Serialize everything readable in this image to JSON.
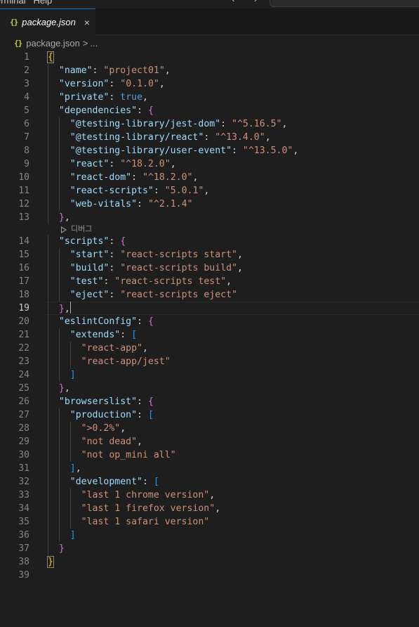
{
  "menubar": {
    "items": "erminal   Help",
    "nav": "‹ ›"
  },
  "tab": {
    "icon": "{}",
    "label": "package.json",
    "close": "×"
  },
  "breadcrumb": {
    "icon": "{}",
    "file": "package.json",
    "separator": ">",
    "ellipsis": "..."
  },
  "codelens": {
    "label": "디버그"
  },
  "editor": {
    "active_line": 19,
    "lines": [
      {
        "n": "1",
        "tokens": [
          [
            "{",
            "t-b1 match"
          ]
        ]
      },
      {
        "n": "2",
        "tokens": [
          [
            "  ",
            ""
          ],
          [
            "\"name\"",
            "t-key"
          ],
          [
            ": ",
            "t-punc"
          ],
          [
            "\"project01\"",
            "t-str"
          ],
          [
            ",",
            "t-punc"
          ]
        ]
      },
      {
        "n": "3",
        "tokens": [
          [
            "  ",
            ""
          ],
          [
            "\"version\"",
            "t-key"
          ],
          [
            ": ",
            "t-punc"
          ],
          [
            "\"0.1.0\"",
            "t-str"
          ],
          [
            ",",
            "t-punc"
          ]
        ]
      },
      {
        "n": "4",
        "tokens": [
          [
            "  ",
            ""
          ],
          [
            "\"private\"",
            "t-key"
          ],
          [
            ": ",
            "t-punc"
          ],
          [
            "true",
            "t-kw"
          ],
          [
            ",",
            "t-punc"
          ]
        ]
      },
      {
        "n": "5",
        "tokens": [
          [
            "  ",
            ""
          ],
          [
            "\"dependencies\"",
            "t-key"
          ],
          [
            ": ",
            "t-punc"
          ],
          [
            "{",
            "t-b2"
          ]
        ]
      },
      {
        "n": "6",
        "tokens": [
          [
            "    ",
            ""
          ],
          [
            "\"@testing-library/jest-dom\"",
            "t-key"
          ],
          [
            ": ",
            "t-punc"
          ],
          [
            "\"^5.16.5\"",
            "t-str"
          ],
          [
            ",",
            "t-punc"
          ]
        ]
      },
      {
        "n": "7",
        "tokens": [
          [
            "    ",
            ""
          ],
          [
            "\"@testing-library/react\"",
            "t-key"
          ],
          [
            ": ",
            "t-punc"
          ],
          [
            "\"^13.4.0\"",
            "t-str"
          ],
          [
            ",",
            "t-punc"
          ]
        ]
      },
      {
        "n": "8",
        "tokens": [
          [
            "    ",
            ""
          ],
          [
            "\"@testing-library/user-event\"",
            "t-key"
          ],
          [
            ": ",
            "t-punc"
          ],
          [
            "\"^13.5.0\"",
            "t-str"
          ],
          [
            ",",
            "t-punc"
          ]
        ]
      },
      {
        "n": "9",
        "tokens": [
          [
            "    ",
            ""
          ],
          [
            "\"react\"",
            "t-key"
          ],
          [
            ": ",
            "t-punc"
          ],
          [
            "\"^18.2.0\"",
            "t-str"
          ],
          [
            ",",
            "t-punc"
          ]
        ]
      },
      {
        "n": "10",
        "tokens": [
          [
            "    ",
            ""
          ],
          [
            "\"react-dom\"",
            "t-key"
          ],
          [
            ": ",
            "t-punc"
          ],
          [
            "\"^18.2.0\"",
            "t-str"
          ],
          [
            ",",
            "t-punc"
          ]
        ]
      },
      {
        "n": "11",
        "tokens": [
          [
            "    ",
            ""
          ],
          [
            "\"react-scripts\"",
            "t-key"
          ],
          [
            ": ",
            "t-punc"
          ],
          [
            "\"5.0.1\"",
            "t-str"
          ],
          [
            ",",
            "t-punc"
          ]
        ]
      },
      {
        "n": "12",
        "tokens": [
          [
            "    ",
            ""
          ],
          [
            "\"web-vitals\"",
            "t-key"
          ],
          [
            ": ",
            "t-punc"
          ],
          [
            "\"^2.1.4\"",
            "t-str"
          ]
        ]
      },
      {
        "n": "13",
        "tokens": [
          [
            "  ",
            ""
          ],
          [
            "}",
            "t-b2"
          ],
          [
            ",",
            "t-punc"
          ]
        ],
        "codelens_after": true
      },
      {
        "n": "14",
        "tokens": [
          [
            "  ",
            ""
          ],
          [
            "\"scripts\"",
            "t-key"
          ],
          [
            ": ",
            "t-punc"
          ],
          [
            "{",
            "t-b2"
          ]
        ]
      },
      {
        "n": "15",
        "tokens": [
          [
            "    ",
            ""
          ],
          [
            "\"start\"",
            "t-key"
          ],
          [
            ": ",
            "t-punc"
          ],
          [
            "\"react-scripts start\"",
            "t-str"
          ],
          [
            ",",
            "t-punc"
          ]
        ]
      },
      {
        "n": "16",
        "tokens": [
          [
            "    ",
            ""
          ],
          [
            "\"build\"",
            "t-key"
          ],
          [
            ": ",
            "t-punc"
          ],
          [
            "\"react-scripts build\"",
            "t-str"
          ],
          [
            ",",
            "t-punc"
          ]
        ]
      },
      {
        "n": "17",
        "tokens": [
          [
            "    ",
            ""
          ],
          [
            "\"test\"",
            "t-key"
          ],
          [
            ": ",
            "t-punc"
          ],
          [
            "\"react-scripts test\"",
            "t-str"
          ],
          [
            ",",
            "t-punc"
          ]
        ]
      },
      {
        "n": "18",
        "tokens": [
          [
            "    ",
            ""
          ],
          [
            "\"eject\"",
            "t-key"
          ],
          [
            ": ",
            "t-punc"
          ],
          [
            "\"react-scripts eject\"",
            "t-str"
          ]
        ]
      },
      {
        "n": "19",
        "tokens": [
          [
            "  ",
            ""
          ],
          [
            "}",
            "t-b2"
          ],
          [
            ",",
            "t-punc"
          ]
        ],
        "cursor": true
      },
      {
        "n": "20",
        "tokens": [
          [
            "  ",
            ""
          ],
          [
            "\"eslintConfig\"",
            "t-key"
          ],
          [
            ": ",
            "t-punc"
          ],
          [
            "{",
            "t-b2"
          ]
        ]
      },
      {
        "n": "21",
        "tokens": [
          [
            "    ",
            ""
          ],
          [
            "\"extends\"",
            "t-key"
          ],
          [
            ": ",
            "t-punc"
          ],
          [
            "[",
            "t-b3"
          ]
        ]
      },
      {
        "n": "22",
        "tokens": [
          [
            "      ",
            ""
          ],
          [
            "\"react-app\"",
            "t-str"
          ],
          [
            ",",
            "t-punc"
          ]
        ]
      },
      {
        "n": "23",
        "tokens": [
          [
            "      ",
            ""
          ],
          [
            "\"react-app/jest\"",
            "t-str"
          ]
        ]
      },
      {
        "n": "24",
        "tokens": [
          [
            "    ",
            ""
          ],
          [
            "]",
            "t-b3"
          ]
        ]
      },
      {
        "n": "25",
        "tokens": [
          [
            "  ",
            ""
          ],
          [
            "}",
            "t-b2"
          ],
          [
            ",",
            "t-punc"
          ]
        ]
      },
      {
        "n": "26",
        "tokens": [
          [
            "  ",
            ""
          ],
          [
            "\"browserslist\"",
            "t-key"
          ],
          [
            ": ",
            "t-punc"
          ],
          [
            "{",
            "t-b2"
          ]
        ]
      },
      {
        "n": "27",
        "tokens": [
          [
            "    ",
            ""
          ],
          [
            "\"production\"",
            "t-key"
          ],
          [
            ": ",
            "t-punc"
          ],
          [
            "[",
            "t-b3"
          ]
        ]
      },
      {
        "n": "28",
        "tokens": [
          [
            "      ",
            ""
          ],
          [
            "\">0.2%\"",
            "t-str"
          ],
          [
            ",",
            "t-punc"
          ]
        ]
      },
      {
        "n": "29",
        "tokens": [
          [
            "      ",
            ""
          ],
          [
            "\"not dead\"",
            "t-str"
          ],
          [
            ",",
            "t-punc"
          ]
        ]
      },
      {
        "n": "30",
        "tokens": [
          [
            "      ",
            ""
          ],
          [
            "\"not op_mini all\"",
            "t-str"
          ]
        ]
      },
      {
        "n": "31",
        "tokens": [
          [
            "    ",
            ""
          ],
          [
            "]",
            "t-b3"
          ],
          [
            ",",
            "t-punc"
          ]
        ]
      },
      {
        "n": "32",
        "tokens": [
          [
            "    ",
            ""
          ],
          [
            "\"development\"",
            "t-key"
          ],
          [
            ": ",
            "t-punc"
          ],
          [
            "[",
            "t-b3"
          ]
        ]
      },
      {
        "n": "33",
        "tokens": [
          [
            "      ",
            ""
          ],
          [
            "\"last 1 chrome version\"",
            "t-str"
          ],
          [
            ",",
            "t-punc"
          ]
        ]
      },
      {
        "n": "34",
        "tokens": [
          [
            "      ",
            ""
          ],
          [
            "\"last 1 firefox version\"",
            "t-str"
          ],
          [
            ",",
            "t-punc"
          ]
        ]
      },
      {
        "n": "35",
        "tokens": [
          [
            "      ",
            ""
          ],
          [
            "\"last 1 safari version\"",
            "t-str"
          ]
        ]
      },
      {
        "n": "36",
        "tokens": [
          [
            "    ",
            ""
          ],
          [
            "]",
            "t-b3"
          ]
        ]
      },
      {
        "n": "37",
        "tokens": [
          [
            "  ",
            ""
          ],
          [
            "}",
            "t-b2"
          ]
        ]
      },
      {
        "n": "38",
        "tokens": [
          [
            "}",
            "t-b1 match"
          ]
        ]
      },
      {
        "n": "39",
        "tokens": []
      }
    ]
  }
}
